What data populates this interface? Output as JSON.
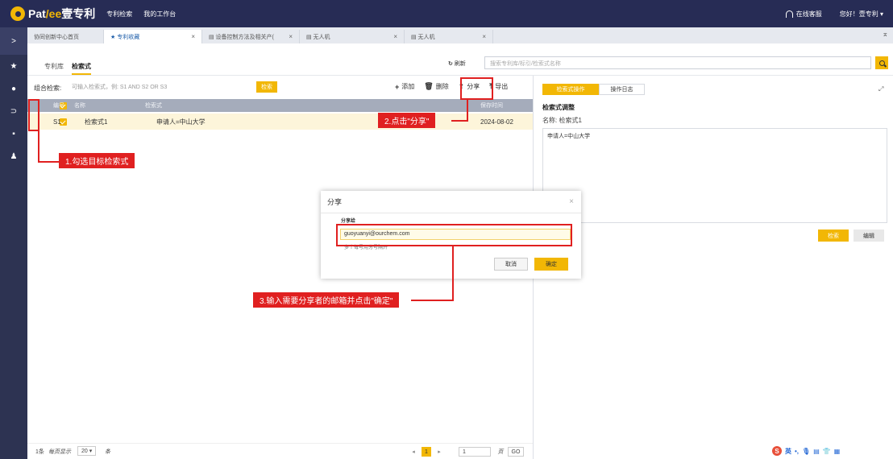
{
  "app": {
    "logo_text_a": "Pat",
    "logo_text_b": "/ee",
    "logo_text_c": "壹专利",
    "nav": [
      "专利检索",
      "我的工作台"
    ],
    "support": "在线客服",
    "greeting": "您好！壹专利 ▾"
  },
  "tabs": [
    {
      "label": "协同创新中心首页"
    },
    {
      "label": "★ 专利收藏"
    },
    {
      "label": "▤ 设备控制方法及相关产("
    },
    {
      "label": "▤ 无人机"
    },
    {
      "label": "▤ 无人机"
    }
  ],
  "subbar": {
    "tab_library": "专利库",
    "tab_query": "检索式",
    "refresh": "刷新",
    "search_placeholder": "搜索专利库/标引/检索式名称"
  },
  "combo": {
    "label": "组合检索:",
    "placeholder": "可输入检索式，例: S1 AND S2 OR S3",
    "button": "检索"
  },
  "actions": {
    "add": "添加",
    "delete": "删除",
    "share": "分享",
    "export": "导出"
  },
  "table": {
    "headers": [
      "编号",
      "名称",
      "检索式",
      "保存时间"
    ],
    "rows": [
      {
        "id": "S1",
        "name": "检索式1",
        "expr": "申请人=中山大学",
        "date": "2024-08-02"
      }
    ]
  },
  "pager": {
    "count": "1条",
    "per_page_label": "每页显示",
    "per_page": "20",
    "unit": "条",
    "current": "1",
    "goto_value": "1",
    "page_label": "页",
    "go": "GO"
  },
  "right_panel": {
    "tab_ops": "检索式操作",
    "tab_log": "操作日志",
    "section_title": "检索式调整",
    "name_line": "名称: 检索式1",
    "expr": "申请人=中山大学",
    "search_btn": "检索",
    "edit_btn": "编辑"
  },
  "modal": {
    "title": "分享",
    "subtitle": "分享给",
    "email": "guoyuanyi@ourchem.com",
    "hint": "多个每号用分号隔开",
    "cancel": "取消",
    "ok": "确定"
  },
  "annotations": {
    "step1": "1.勾选目标检索式",
    "step2": "2.点击\"分享\"",
    "step3": "3.输入需要分享者的邮箱并点击\"确定\"",
    "color": "#e02020"
  },
  "ime": {
    "logo": "S",
    "lang": "英"
  },
  "colors": {
    "accent": "#f2b705",
    "header": "#272c55",
    "rail": "#2d3352"
  }
}
